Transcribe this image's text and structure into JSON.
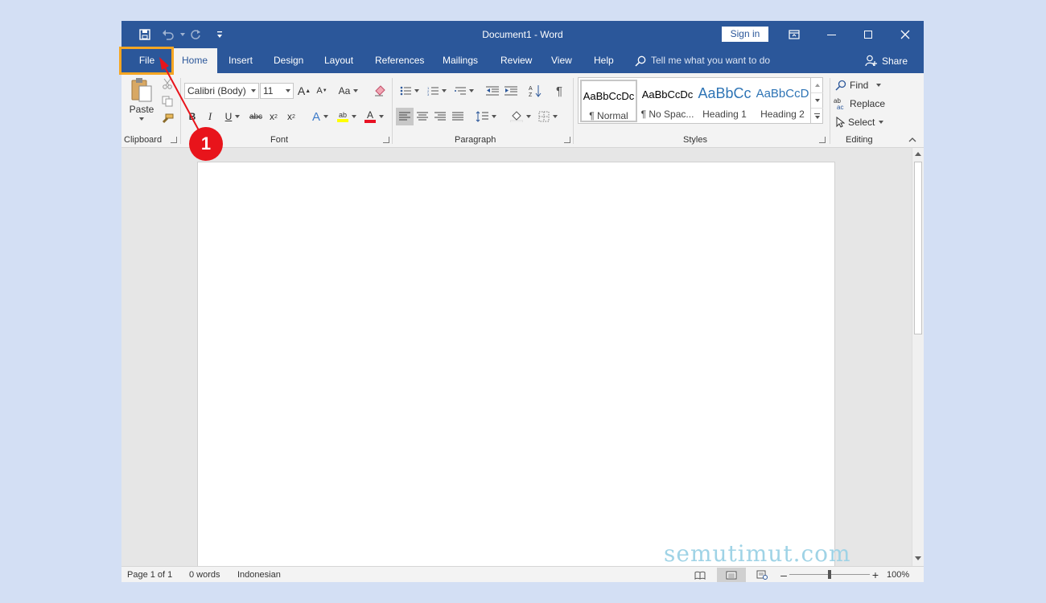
{
  "window": {
    "title": "Document1  -  Word",
    "sign_in": "Sign in"
  },
  "tabs": [
    {
      "label": "File"
    },
    {
      "label": "Home"
    },
    {
      "label": "Insert"
    },
    {
      "label": "Design"
    },
    {
      "label": "Layout"
    },
    {
      "label": "References"
    },
    {
      "label": "Mailings"
    },
    {
      "label": "Review"
    },
    {
      "label": "View"
    },
    {
      "label": "Help"
    }
  ],
  "tell_me": "Tell me what you want to do",
  "share": "Share",
  "ribbon": {
    "clipboard": {
      "label": "Clipboard",
      "paste": "Paste"
    },
    "font": {
      "label": "Font",
      "name": "Calibri (Body)",
      "size": "11",
      "change_case": "Aa"
    },
    "paragraph": {
      "label": "Paragraph"
    },
    "styles": {
      "label": "Styles",
      "items": [
        {
          "preview": "AaBbCcDc",
          "name": "¶ Normal"
        },
        {
          "preview": "AaBbCcDc",
          "name": "¶ No Spac..."
        },
        {
          "preview": "AaBbCc",
          "name": "Heading 1"
        },
        {
          "preview": "AaBbCcD",
          "name": "Heading 2"
        }
      ]
    },
    "editing": {
      "label": "Editing",
      "find": "Find",
      "replace": "Replace",
      "select": "Select"
    }
  },
  "status": {
    "page": "Page 1 of 1",
    "words": "0 words",
    "language": "Indonesian",
    "zoom": "100%"
  },
  "watermark": "semutimut.com",
  "annotation": {
    "step": "1"
  },
  "colors": {
    "title_bar": "#2b579a",
    "highlight": "#f5a623",
    "badge": "#e8141b"
  }
}
